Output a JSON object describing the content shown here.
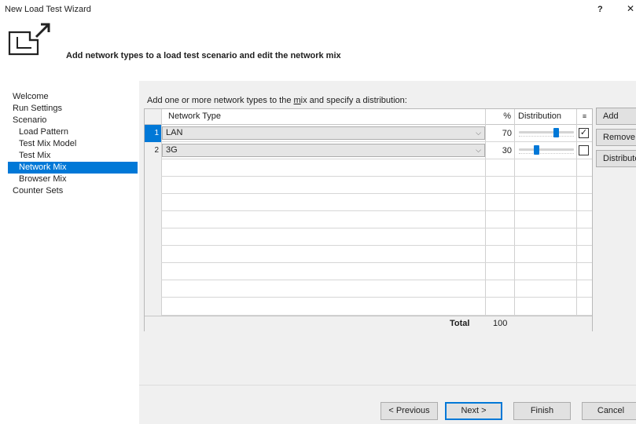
{
  "window": {
    "title": "New Load Test Wizard",
    "help": "?",
    "close": "✕"
  },
  "header": {
    "text": "Add network types to a load test scenario and edit the network mix"
  },
  "nav": {
    "items": [
      {
        "label": "Welcome"
      },
      {
        "label": "Run Settings"
      },
      {
        "label": "Scenario"
      },
      {
        "label": "Load Pattern"
      },
      {
        "label": "Test Mix Model"
      },
      {
        "label": "Test Mix"
      },
      {
        "label": "Network Mix"
      },
      {
        "label": "Browser Mix"
      },
      {
        "label": "Counter Sets"
      }
    ],
    "selected": "Network Mix"
  },
  "content": {
    "instruction_pre": "Add one or more network types to the ",
    "instruction_key": "m",
    "instruction_post": "ix and specify a distribution:",
    "grid": {
      "headers": {
        "network_type": "Network Type",
        "percent": "%",
        "distribution": "Distribution",
        "lock": "≡"
      },
      "rows": [
        {
          "num": "1",
          "network_type": "LAN",
          "percent": "70",
          "distribution": 0.7,
          "locked": true
        },
        {
          "num": "2",
          "network_type": "3G",
          "percent": "30",
          "distribution": 0.3,
          "locked": false
        }
      ],
      "total_label": "Total",
      "total_value": "100"
    },
    "side_buttons": {
      "add": "Add",
      "remove": "Remove",
      "distribute": "Distribute"
    }
  },
  "footer": {
    "previous": "< Previous",
    "next": "Next >",
    "finish": "Finish",
    "cancel": "Cancel"
  }
}
